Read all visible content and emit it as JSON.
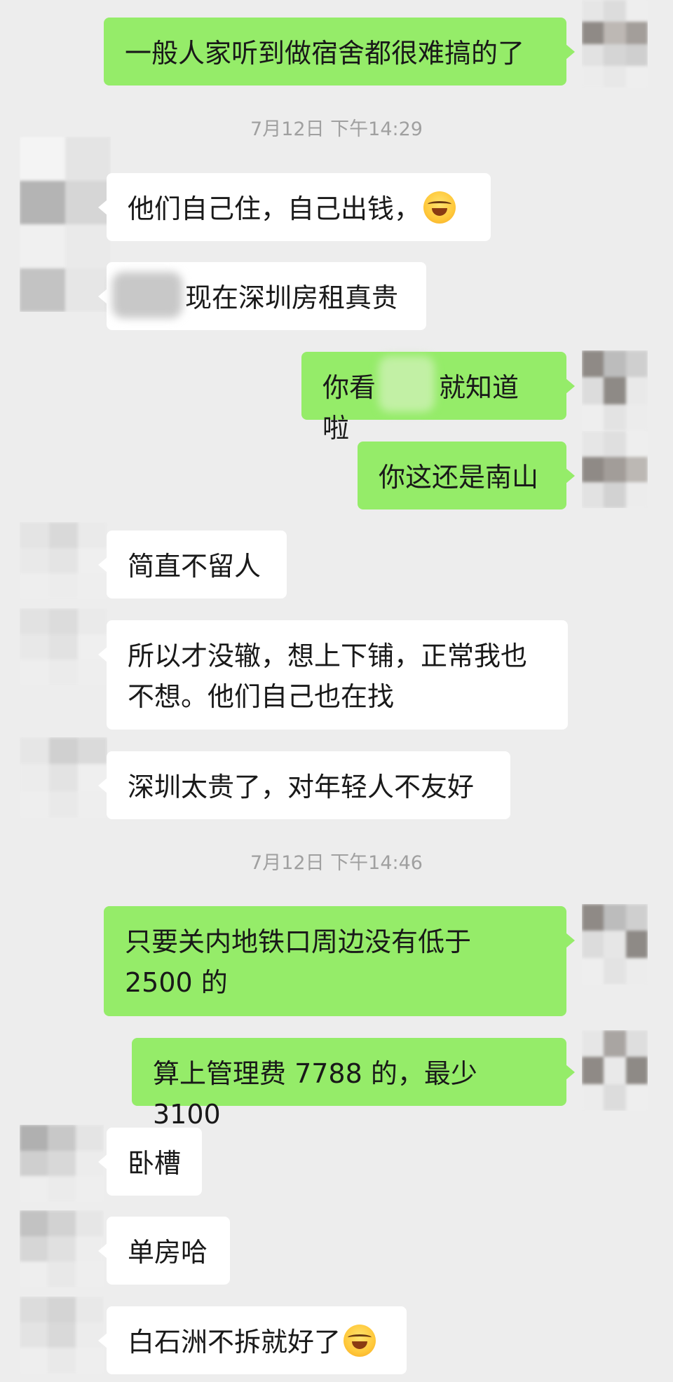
{
  "timestamps": [
    "7月12日 下午14:29",
    "7月12日 下午14:46"
  ],
  "messages": [
    {
      "side": "out",
      "text": "一般人家听到做宿舍都很难搞的了",
      "emoji": ""
    },
    {
      "side": "in",
      "text": "他们自己住，自己出钱，",
      "emoji": "face-with-tears-of-joy"
    },
    {
      "side": "in",
      "text": "现在深圳房租真贵",
      "emoji": ""
    },
    {
      "side": "out",
      "text": "你看",
      "text2": "就知道啦",
      "emoji": ""
    },
    {
      "side": "out",
      "text": "你这还是南山",
      "emoji": ""
    },
    {
      "side": "in",
      "text": "简直不留人",
      "emoji": ""
    },
    {
      "side": "in",
      "text": "所以才没辙，想上下铺，正常我也不想。他们自己也在找",
      "emoji": ""
    },
    {
      "side": "in",
      "text": "深圳太贵了，对年轻人不友好",
      "emoji": ""
    },
    {
      "side": "out",
      "text": "只要关内地铁口周边没有低于 2500 的",
      "emoji": ""
    },
    {
      "side": "out",
      "text": "算上管理费 7788 的，最少 3100",
      "emoji": ""
    },
    {
      "side": "in",
      "text": "卧槽",
      "emoji": ""
    },
    {
      "side": "in",
      "text": "单房哈",
      "emoji": ""
    },
    {
      "side": "in",
      "text": "白石洲不拆就好了",
      "emoji": "face-with-tears-of-joy"
    }
  ],
  "colors": {
    "background": "#ededed",
    "outgoing_bubble": "#95ec69",
    "incoming_bubble": "#ffffff",
    "timestamp_text": "#a0a0a0"
  }
}
